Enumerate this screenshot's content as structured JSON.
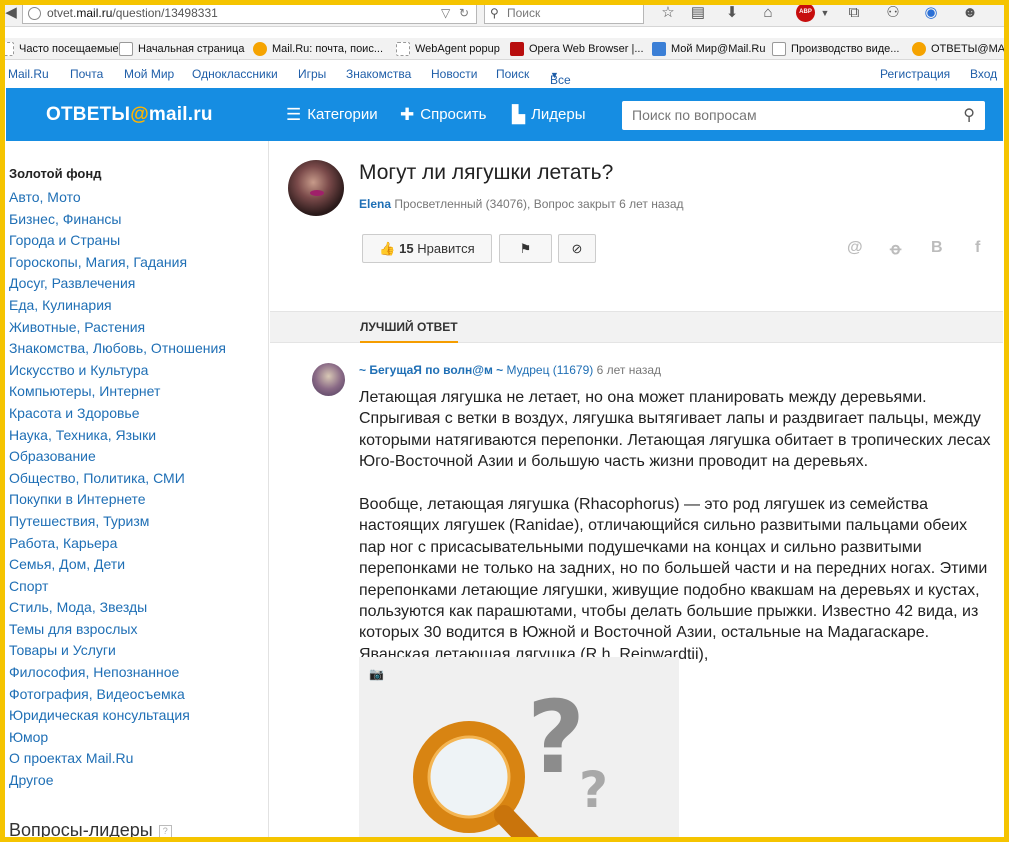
{
  "browser": {
    "url_prefix": "otvet.",
    "url_domain": "mail.ru",
    "url_path": "/question/13498331",
    "search_placeholder": "Поиск",
    "abp_label": "ABP"
  },
  "bookmarks": [
    {
      "label": "Часто посещаемые",
      "icon": "page-icon"
    },
    {
      "label": "Начальная страница",
      "icon": "page-icon"
    },
    {
      "label": "Mail.Ru: почта, поис...",
      "icon": "mailru-at-icon"
    },
    {
      "label": "WebAgent popup",
      "icon": "page-icon"
    },
    {
      "label": "Opera Web Browser |...",
      "icon": "opera-icon"
    },
    {
      "label": "Мой Мир@Mail.Ru",
      "icon": "moimir-icon"
    },
    {
      "label": "Производство виде...",
      "icon": "video-icon"
    },
    {
      "label": "ОТВЕТЫ@MAIL...",
      "icon": "otvety-icon"
    }
  ],
  "portal": {
    "links": [
      "Mail.Ru",
      "Почта",
      "Мой Мир",
      "Одноклассники",
      "Игры",
      "Знакомства",
      "Новости",
      "Поиск",
      "Все проекты"
    ],
    "register": "Регистрация",
    "login": "Вход"
  },
  "header": {
    "logo_left": "ОТВЕТЫ",
    "logo_at": "@",
    "logo_right": "mail.ru",
    "categories": "Категории",
    "ask": "Спросить",
    "leaders": "Лидеры",
    "search_placeholder": "Поиск по вопросам"
  },
  "sidebar": {
    "heading": "Золотой фонд",
    "categories": [
      "Авто, Мото",
      "Бизнес, Финансы",
      "Города и Страны",
      "Гороскопы, Магия, Гадания",
      "Досуг, Развлечения",
      "Еда, Кулинария",
      "Животные, Растения",
      "Знакомства, Любовь, Отношения",
      "Искусство и Культура",
      "Компьютеры, Интернет",
      "Красота и Здоровье",
      "Наука, Техника, Языки",
      "Образование",
      "Общество, Политика, СМИ",
      "Покупки в Интернете",
      "Путешествия, Туризм",
      "Работа, Карьера",
      "Семья, Дом, Дети",
      "Спорт",
      "Стиль, Мода, Звезды",
      "Темы для взрослых",
      "Товары и Услуги",
      "Философия, Непознанное",
      "Фотография, Видеосъемка",
      "Юридическая консультация",
      "Юмор",
      "О проектах Mail.Ru",
      "Другое"
    ],
    "leaders_heading": "Вопросы-лидеры",
    "help": "?"
  },
  "question": {
    "title": "Могут ли лягушки летать?",
    "author": "Elena",
    "meta": " Просветленный (34076), Вопрос закрыт 6 лет назад",
    "likes_count": "15",
    "likes_label": " Нравится"
  },
  "best_answer": {
    "tab_label": "ЛУЧШИЙ ОТВЕТ",
    "author": "~ БегущаЯ по волн@м ~",
    "rank": " Мудрец (11679)",
    "time": " 6 лет назад",
    "paragraph_1": "Летающая лягушка не летает, но она может планировать между деревьями. Спрыгивая с ветки в воздух, лягушка вытягивает лапы и раздвигает пальцы, между которыми натягиваются перепонки. Летающая лягушка обитает в тропических лесах Юго-Восточной Азии и большую часть жизни проводит на деревьях.",
    "paragraph_2": "Вообще, летающая лягушка (Rhacophorus) — это род лягушек из семейства настоящих лягушек (Ranidae), отличающийся сильно развитыми пальцами обеих пар ног с присасывательными подушечками на концах и сильно развитыми перепонками не только на задних, но по большей части и на передних ногах. Этими перепонками летающие лягушки, живущие подобно квакшам на деревьях и кустах, пользуются как парашютами, чтобы делать большие прыжки. Известно 42 вида, из которых 30 водится в Южной и Восточной Азии, остальные на Мадагаскаре. Яванская летающая лягушка (R h. Reinwardtii),"
  },
  "colors": {
    "frame": "#f5c400",
    "header_bg": "#168de2",
    "link": "#1f6fb5",
    "accent": "#f59d00"
  }
}
